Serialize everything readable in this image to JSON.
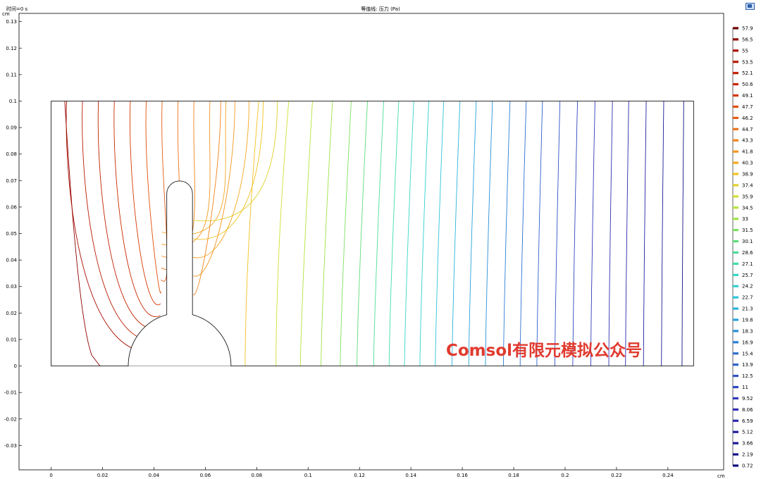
{
  "header": {
    "time_label": "时间=0 s",
    "title": "等值线: 压力 (Pa)",
    "y_unit": "cm",
    "x_unit": "cm"
  },
  "watermark": "Comsol有限元模拟公众号",
  "chart_data": {
    "type": "contour",
    "title": "等值线: 压力 (Pa)",
    "x_ticks": [
      0,
      0.02,
      0.04,
      0.06,
      0.08,
      0.1,
      0.12,
      0.14,
      0.16,
      0.18,
      0.2,
      0.22,
      0.24
    ],
    "x_tick_labels": [
      "0",
      "0.02",
      "0.04",
      "0.06",
      "0.08",
      "0.1",
      "0.12",
      "0.14",
      "0.16",
      "0.18",
      "0.2",
      "0.22",
      "0.24"
    ],
    "y_ticks": [
      -0.03,
      -0.02,
      -0.01,
      0,
      0.01,
      0.02,
      0.03,
      0.04,
      0.05,
      0.06,
      0.07,
      0.08,
      0.09,
      0.1,
      0.11,
      0.12,
      0.13
    ],
    "y_tick_labels": [
      "-0.03",
      "-0.02",
      "-0.01",
      "0",
      "0.01",
      "0.02",
      "0.03",
      "0.04",
      "0.05",
      "0.06",
      "0.07",
      "0.08",
      "0.09",
      "0.1",
      "0.11",
      "0.12",
      "0.13"
    ],
    "xlim": [
      -0.0125,
      0.2617
    ],
    "ylim": [
      -0.0392,
      0.1331
    ],
    "domain": {
      "x": [
        0,
        0.25
      ],
      "y": [
        0,
        0.1
      ]
    },
    "obstacle": {
      "base_half_circle": {
        "center": [
          0.05,
          0
        ],
        "radius": 0.02
      },
      "pillar": {
        "x": [
          0.045,
          0.055
        ],
        "y_top": 0.07,
        "cap_radius": 0.005
      }
    },
    "colorbar": {
      "levels": [
        "57.9",
        "56.5",
        "55",
        "53.5",
        "52.1",
        "50.6",
        "49.1",
        "47.7",
        "46.2",
        "44.7",
        "43.3",
        "41.8",
        "40.3",
        "38.9",
        "37.4",
        "35.9",
        "34.5",
        "33",
        "31.5",
        "30.1",
        "28.6",
        "27.1",
        "25.7",
        "24.2",
        "22.7",
        "21.3",
        "19.8",
        "18.3",
        "16.9",
        "15.4",
        "13.9",
        "12.5",
        "11",
        "9.52",
        "8.06",
        "6.59",
        "5.12",
        "3.66",
        "2.19",
        "0.72"
      ],
      "colors": [
        "#6b0000",
        "#8f0000",
        "#a80d00",
        "#b81a00",
        "#c22000",
        "#cc2800",
        "#d63800",
        "#e04e0a",
        "#e65c14",
        "#ec7218",
        "#f0841a",
        "#f2961e",
        "#f4a820",
        "#f2c020",
        "#e2cf2a",
        "#cfe032",
        "#b6e43c",
        "#9ee246",
        "#7fe060",
        "#5fdc7c",
        "#4cdd98",
        "#3edcb0",
        "#36d6c4",
        "#30cfd0",
        "#2ec4da",
        "#2ab4dc",
        "#28a2da",
        "#2890d8",
        "#2a7fd4",
        "#2c6fd0",
        "#2e60cc",
        "#3052c6",
        "#3246c0",
        "#323aba",
        "#3030b2",
        "#2c28aa",
        "#2420a0",
        "#1c1a94",
        "#141488",
        "#0c0c7a"
      ]
    },
    "contours": [
      {
        "x_bottom": 0.019,
        "color": "#8f0000"
      },
      {
        "x_bottom": 0.0755,
        "color": "#f2c020"
      },
      {
        "x_bottom": 0.0875,
        "color": "#cfe032"
      },
      {
        "x_bottom": 0.097,
        "color": "#b6e43c"
      },
      {
        "x_bottom": 0.105,
        "color": "#9ee246"
      },
      {
        "x_bottom": 0.1125,
        "color": "#7fe060"
      },
      {
        "x_bottom": 0.119,
        "color": "#5fdc7c"
      },
      {
        "x_bottom": 0.1255,
        "color": "#4cdd98"
      },
      {
        "x_bottom": 0.1315,
        "color": "#3edcb0"
      },
      {
        "x_bottom": 0.1375,
        "color": "#36d6c4"
      },
      {
        "x_bottom": 0.1435,
        "color": "#30cfd0"
      },
      {
        "x_bottom": 0.1495,
        "color": "#2ec4da"
      },
      {
        "x_bottom": 0.156,
        "color": "#2ab4dc"
      },
      {
        "x_bottom": 0.1625,
        "color": "#28a2da"
      },
      {
        "x_bottom": 0.169,
        "color": "#2890d8"
      },
      {
        "x_bottom": 0.176,
        "color": "#2a7fd4"
      },
      {
        "x_bottom": 0.1825,
        "color": "#2c6fd0"
      },
      {
        "x_bottom": 0.189,
        "color": "#2e60cc"
      },
      {
        "x_bottom": 0.196,
        "color": "#3052c6"
      },
      {
        "x_bottom": 0.203,
        "color": "#3246c0"
      },
      {
        "x_bottom": 0.21,
        "color": "#323aba"
      },
      {
        "x_bottom": 0.217,
        "color": "#3030b2"
      },
      {
        "x_bottom": 0.2235,
        "color": "#2c28aa"
      },
      {
        "x_bottom": 0.2305,
        "color": "#2420a0"
      },
      {
        "x_bottom": 0.2375,
        "color": "#1c1a94"
      },
      {
        "x_bottom": 0.2455,
        "color": "#141488"
      }
    ]
  }
}
